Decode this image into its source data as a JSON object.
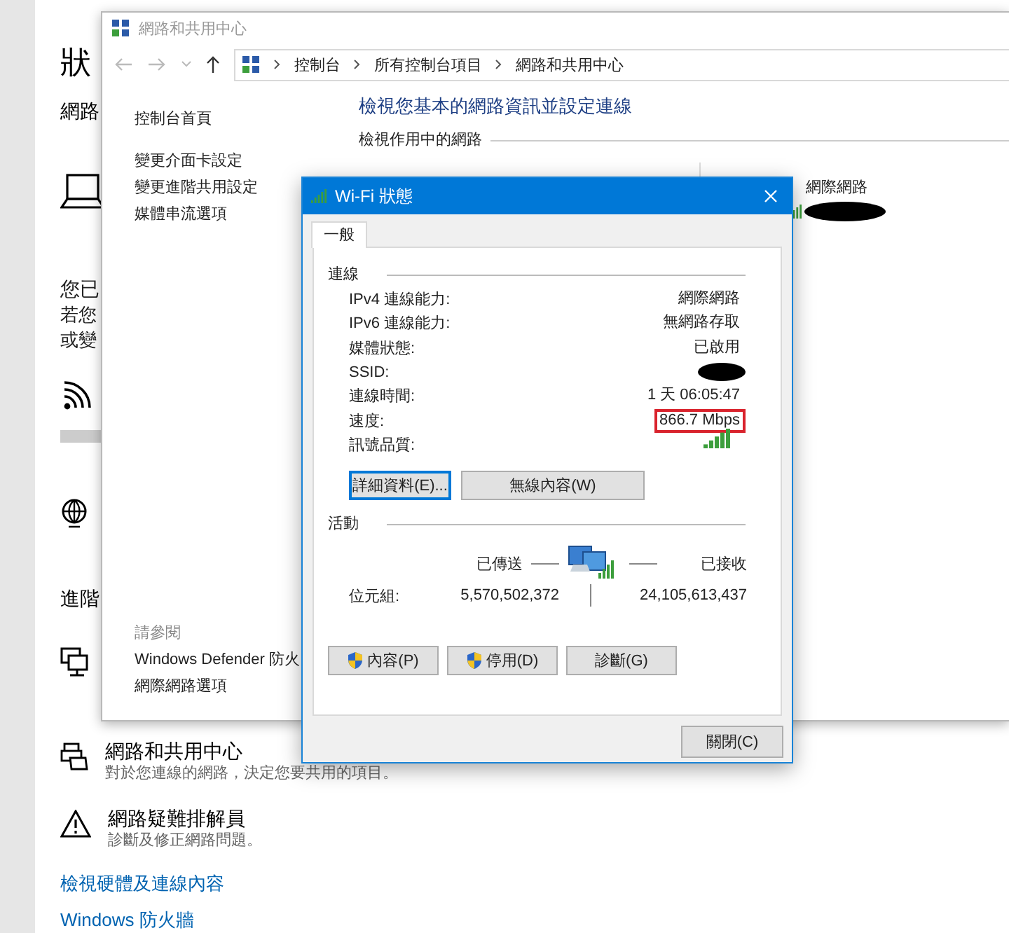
{
  "settings": {
    "heading": "狀",
    "subheading": "網路",
    "partial_lines": [
      {
        "text": "您已",
        "kind": "lead"
      },
      {
        "text": "若您",
        "kind": "body"
      },
      {
        "text": "或變",
        "kind": "body"
      }
    ],
    "advanced_heading": "進階",
    "items": [
      {
        "kind": "sharing",
        "title": "網路和共用中心",
        "description": "對於您連線的網路，決定您要共用的項目。"
      },
      {
        "kind": "troubleshoot",
        "title": "網路疑難排解員",
        "description": "診斷及修正網路問題。"
      }
    ],
    "links": [
      "檢視硬體及連線內容",
      "Windows 防火牆"
    ]
  },
  "control_panel": {
    "title": "網路和共用中心",
    "breadcrumb": [
      "控制台",
      "所有控制台項目",
      "網路和共用中心"
    ],
    "sidebar_links": [
      "控制台首頁",
      "變更介面卡設定",
      "變更進階共用設定",
      "媒體串流選項"
    ],
    "see_also_heading": "請參閱",
    "see_also_links": [
      "Windows Defender 防火",
      "網際網路選項"
    ],
    "heading": "檢視您基本的網路資訊並設定連線",
    "section": "檢視作用中的網路",
    "access_type": "網際網路"
  },
  "wifi_dialog": {
    "title": "Wi-Fi 狀態",
    "tabs": [
      {
        "label": "一般",
        "selected": true
      }
    ],
    "connection_heading": "連線",
    "rows": [
      {
        "kind": "text",
        "label": "IPv4 連線能力:",
        "value": "網際網路",
        "highlighted": false
      },
      {
        "kind": "text",
        "label": "IPv6 連線能力:",
        "value": "無網路存取",
        "highlighted": false
      },
      {
        "kind": "text",
        "label": "媒體狀態:",
        "value": "已啟用",
        "highlighted": false
      },
      {
        "kind": "redacted",
        "label": "SSID:"
      },
      {
        "kind": "text",
        "label": "連線時間:",
        "value": "1 天 06:05:47",
        "highlighted": false
      },
      {
        "kind": "text",
        "label": "速度:",
        "value": "866.7 Mbps",
        "highlighted": true
      },
      {
        "kind": "signal",
        "label": "訊號品質:"
      }
    ],
    "detail_buttons": [
      {
        "label": "詳細資料(E)...",
        "focused": true
      },
      {
        "label": "無線內容(W)",
        "focused": false
      }
    ],
    "activity_heading": "活動",
    "sent_label": "已傳送",
    "received_label": "已接收",
    "bytes_label": "位元組:",
    "bytes_sent": "5,570,502,372",
    "bytes_received": "24,105,613,437",
    "action_buttons": [
      {
        "label": "內容(P)",
        "shield": true
      },
      {
        "label": "停用(D)",
        "shield": true
      },
      {
        "label": "診斷(G)",
        "shield": false
      }
    ],
    "close_button": "關閉(C)"
  }
}
